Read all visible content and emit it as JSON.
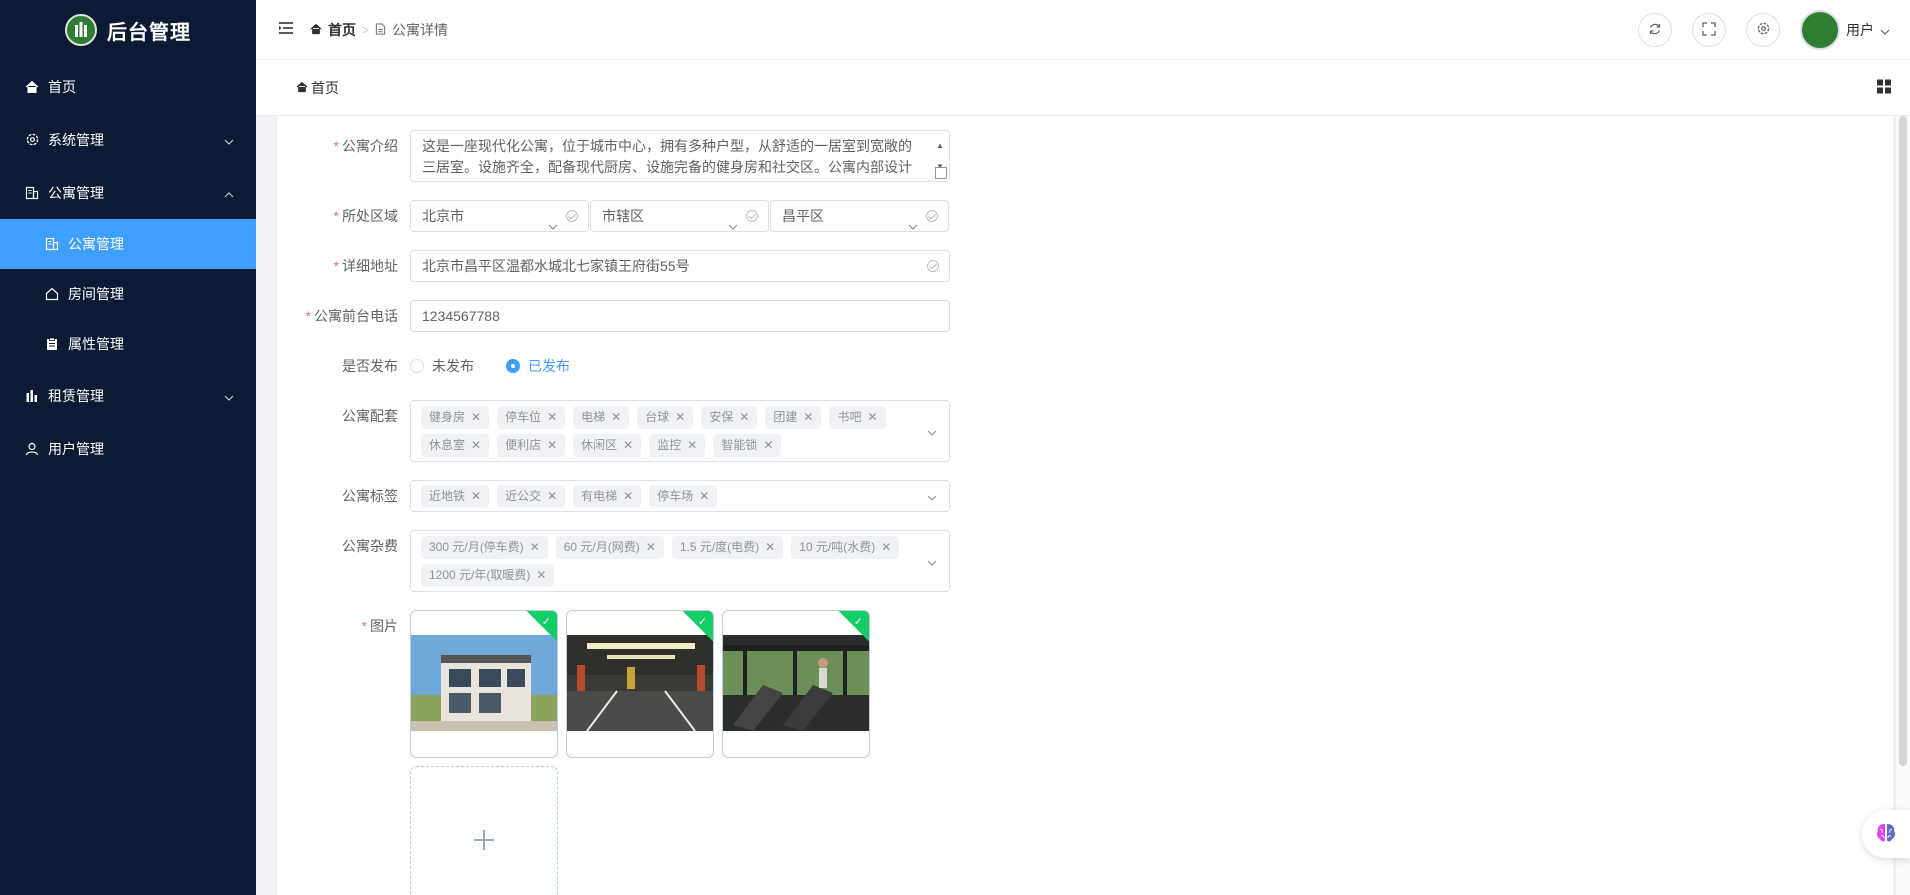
{
  "app": {
    "title": "后台管理"
  },
  "sidebar": {
    "items": [
      {
        "label": "首页",
        "icon": "home-icon"
      },
      {
        "label": "系统管理",
        "icon": "gear-icon"
      },
      {
        "label": "公寓管理",
        "icon": "building-icon"
      },
      {
        "label": "租赁管理",
        "icon": "chart-icon"
      },
      {
        "label": "用户管理",
        "icon": "user-icon"
      }
    ],
    "sub_items": [
      {
        "label": "公寓管理",
        "icon": "building-icon",
        "active": true
      },
      {
        "label": "房间管理",
        "icon": "house-icon"
      },
      {
        "label": "属性管理",
        "icon": "clipboard-icon"
      }
    ]
  },
  "header": {
    "breadcrumb": [
      "首页",
      "公寓详情"
    ],
    "user_label": "用户"
  },
  "tabs": {
    "home": "首页"
  },
  "form": {
    "intro": {
      "label": "公寓介绍",
      "value": "这是一座现代化公寓，位于城市中心，拥有多种户型，从舒适的一居室到宽敞的三居室。设施齐全，配备现代厨房、设施完备的健身房和社交区。公寓内部设计"
    },
    "region": {
      "label": "所处区域",
      "province": "北京市",
      "city": "市辖区",
      "district": "昌平区"
    },
    "address": {
      "label": "详细地址",
      "value": "北京市昌平区温都水城北七家镇王府街55号"
    },
    "phone": {
      "label": "公寓前台电话",
      "value": "1234567788"
    },
    "publish": {
      "label": "是否发布",
      "options": [
        "未发布",
        "已发布"
      ],
      "selected": "已发布"
    },
    "facilities": {
      "label": "公寓配套",
      "tags": [
        "健身房",
        "停车位",
        "电梯",
        "台球",
        "安保",
        "团建",
        "书吧",
        "休息室",
        "便利店",
        "休闲区",
        "监控",
        "智能锁"
      ]
    },
    "labels": {
      "label": "公寓标签",
      "tags": [
        "近地铁",
        "近公交",
        "有电梯",
        "停车场"
      ]
    },
    "fees": {
      "label": "公寓杂费",
      "tags": [
        "300 元/月(停车费)",
        "60 元/月(网费)",
        "1.5 元/度(电费)",
        "10 元/吨(水费)",
        "1200 元/年(取暖费)"
      ]
    },
    "images": {
      "label": "图片",
      "count": 3
    }
  },
  "colors": {
    "sidebar_bg": "#0c1a33",
    "accent": "#409eff",
    "required": "#f56c6c",
    "success": "#13ce66"
  }
}
